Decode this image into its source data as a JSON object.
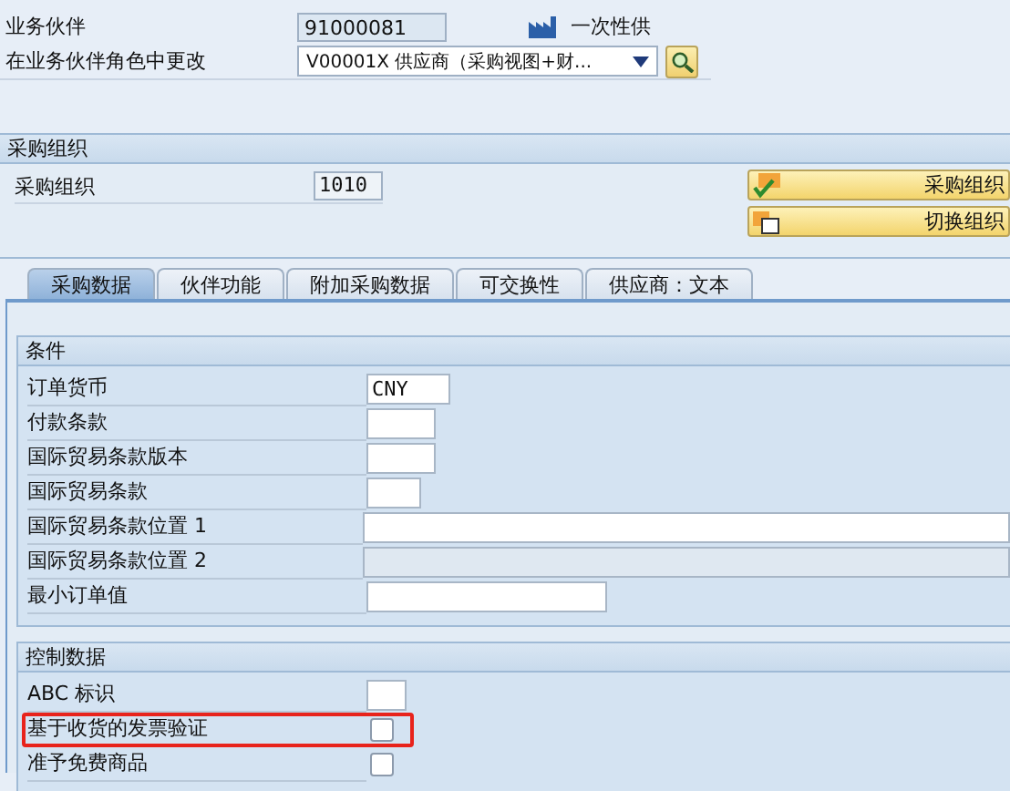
{
  "header": {
    "fields": [
      {
        "label": "业务伙伴",
        "kind": "display",
        "value": "91000081"
      },
      {
        "label": "在业务伙伴角色中更改",
        "kind": "dropdown",
        "value": "V00001X 供应商（采购视图+财..."
      }
    ],
    "partner_type": "一次性供"
  },
  "purchasing_org": {
    "title": "采购组织",
    "label": "采购组织",
    "value": "1010",
    "buttons": [
      {
        "label": "采购组织"
      },
      {
        "label": "切换组织"
      }
    ]
  },
  "tabs": [
    {
      "label": "采购数据",
      "selected": true
    },
    {
      "label": "伙伴功能",
      "selected": false
    },
    {
      "label": "附加采购数据",
      "selected": false
    },
    {
      "label": "可交换性",
      "selected": false
    },
    {
      "label": "供应商：文本",
      "selected": false
    }
  ],
  "groups": [
    {
      "title": "条件",
      "rows": [
        {
          "label": "订单货币",
          "kind": "text",
          "value": "CNY",
          "disabled": false
        },
        {
          "label": "付款条款",
          "kind": "text",
          "value": "",
          "disabled": false
        },
        {
          "label": "国际贸易条款版本",
          "kind": "text",
          "value": "",
          "disabled": false
        },
        {
          "label": "国际贸易条款",
          "kind": "text",
          "value": "",
          "disabled": false
        },
        {
          "label": "国际贸易条款位置 1",
          "kind": "text",
          "value": "",
          "disabled": false
        },
        {
          "label": "国际贸易条款位置 2",
          "kind": "text",
          "value": "",
          "disabled": true
        },
        {
          "label": "最小订单值",
          "kind": "text",
          "value": "",
          "disabled": false
        }
      ]
    },
    {
      "title": "控制数据",
      "rows": [
        {
          "label": "ABC 标识",
          "kind": "text",
          "value": "",
          "disabled": false
        },
        {
          "label": "基于收货的发票验证",
          "kind": "checkbox",
          "checked": false,
          "highlighted": true
        },
        {
          "label": "准予免费商品",
          "kind": "checkbox",
          "checked": false,
          "highlighted": false
        }
      ]
    }
  ]
}
